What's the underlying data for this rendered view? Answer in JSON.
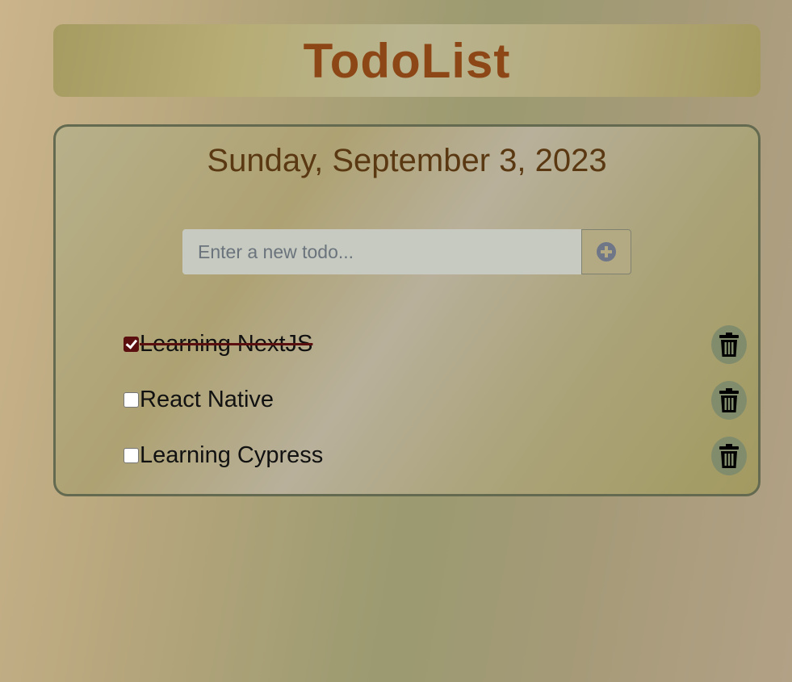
{
  "header": {
    "title": "TodoList"
  },
  "main": {
    "date": "Sunday, September 3, 2023",
    "new_todo": {
      "placeholder": "Enter a new todo...",
      "value": "",
      "add_icon": "plus-circle-icon"
    },
    "todos": [
      {
        "text": "Learning NextJS",
        "completed": true,
        "delete_icon": "trash-icon"
      },
      {
        "text": "React Native",
        "completed": false,
        "delete_icon": "trash-icon"
      },
      {
        "text": "Learning Cypress",
        "completed": false,
        "delete_icon": "trash-icon"
      }
    ]
  },
  "colors": {
    "title": "#8d4716",
    "date": "#5a3812",
    "checked": "#5b0f0f",
    "delete_button": "#818c6c",
    "card_border": "#646a50"
  }
}
